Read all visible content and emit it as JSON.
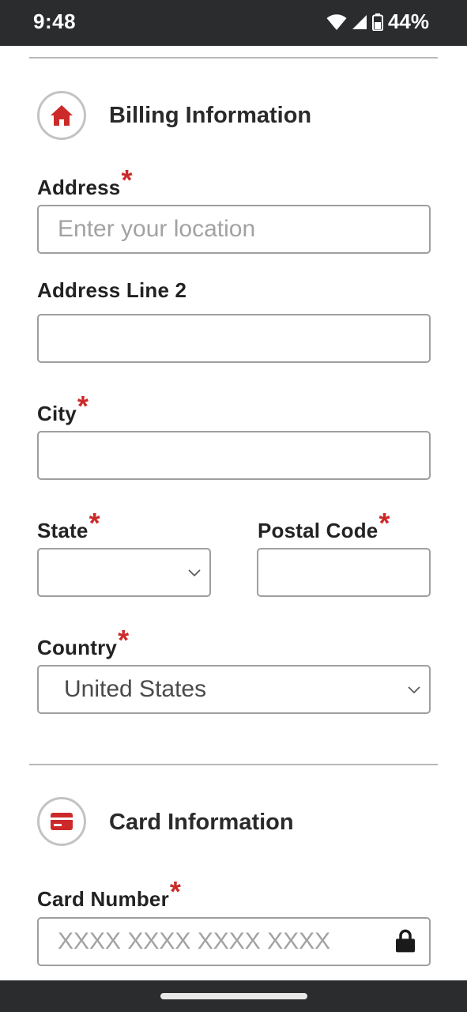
{
  "status_bar": {
    "time": "9:48",
    "battery_percent": "44%",
    "icons": [
      "wifi-icon",
      "cell-signal-icon",
      "battery-icon"
    ]
  },
  "billing": {
    "title": "Billing Information",
    "icon": "home-icon",
    "address_label": "Address",
    "address_placeholder": "Enter your location",
    "address2_label": "Address Line 2",
    "city_label": "City",
    "state_label": "State",
    "state_value": "",
    "postal_label": "Postal Code",
    "country_label": "Country",
    "country_value": "United States"
  },
  "card": {
    "title": "Card Information",
    "icon": "credit-card-icon",
    "card_number_label": "Card Number",
    "card_number_placeholder": "XXXX XXXX XXXX XXXX",
    "lock_icon": "lock-icon"
  },
  "required_marker": "*",
  "colors": {
    "accent": "#cc2a2a",
    "system_bar": "#2b2c2e",
    "border": "#9f9f9f"
  }
}
